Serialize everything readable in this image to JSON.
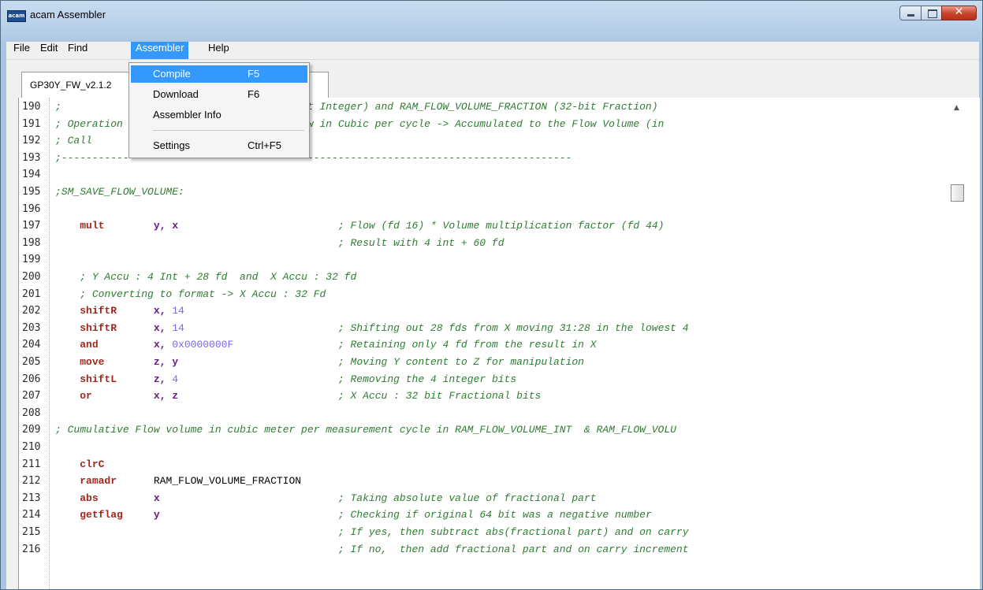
{
  "window": {
    "title": "acam Assembler",
    "app_icon_text": "acam"
  },
  "menubar": [
    "File",
    "Edit",
    "Find",
    "Assembler",
    "Help"
  ],
  "tab": {
    "label": "GP30Y_FW_v2.1.2"
  },
  "dropdown": {
    "items": [
      {
        "label": "Compile",
        "shortcut": "F5"
      },
      {
        "label": "Download",
        "shortcut": "F6"
      },
      {
        "label": "Assembler Info",
        "shortcut": ""
      },
      {
        "label": "Settings",
        "shortcut": "Ctrl+F5"
      }
    ]
  },
  "editor": {
    "lines": [
      {
        "n": "190",
        "parts": [
          {
            "c": "cm",
            "t": ";                       VOLUME_INT (32-bit Integer) and RAM_FLOW_VOLUME_FRACTION (32-bit Fraction)"
          }
        ]
      },
      {
        "n": "191",
        "parts": [
          {
            "c": "cm",
            "t": "; Operation : Flow * VOLUME_FACTOR -> Flow in Cubic per cycle -> Accumulated to the Flow Volume (in"
          }
        ]
      },
      {
        "n": "192",
        "parts": [
          {
            "c": "cm",
            "t": "; Call"
          }
        ]
      },
      {
        "n": "193",
        "parts": [
          {
            "c": "cm",
            "t": ";-----------------------------------------------------------------------------------"
          }
        ]
      },
      {
        "n": "194",
        "parts": []
      },
      {
        "n": "195",
        "parts": [
          {
            "c": "cm",
            "t": ";SM_SAVE_FLOW_VOLUME:"
          }
        ]
      },
      {
        "n": "196",
        "parts": []
      },
      {
        "n": "197",
        "parts": [
          {
            "c": "id",
            "t": "    "
          },
          {
            "c": "kw",
            "t": "mult"
          },
          {
            "c": "id",
            "t": "        "
          },
          {
            "c": "op",
            "t": "y, x"
          },
          {
            "c": "id",
            "t": "                          "
          },
          {
            "c": "cm",
            "t": "; Flow (fd 16) * Volume multiplication factor (fd 44)"
          }
        ]
      },
      {
        "n": "198",
        "parts": [
          {
            "c": "id",
            "t": "                                              "
          },
          {
            "c": "cm",
            "t": "; Result with 4 int + 60 fd"
          }
        ]
      },
      {
        "n": "199",
        "parts": []
      },
      {
        "n": "200",
        "parts": [
          {
            "c": "id",
            "t": "    "
          },
          {
            "c": "cm",
            "t": "; Y Accu : 4 Int + 28 fd  and  X Accu : 32 fd"
          }
        ]
      },
      {
        "n": "201",
        "parts": [
          {
            "c": "id",
            "t": "    "
          },
          {
            "c": "cm",
            "t": "; Converting to format -> X Accu : 32 Fd"
          }
        ]
      },
      {
        "n": "202",
        "parts": [
          {
            "c": "id",
            "t": "    "
          },
          {
            "c": "kw",
            "t": "shiftR"
          },
          {
            "c": "id",
            "t": "      "
          },
          {
            "c": "op",
            "t": "x, "
          },
          {
            "c": "num",
            "t": "14"
          }
        ]
      },
      {
        "n": "203",
        "parts": [
          {
            "c": "id",
            "t": "    "
          },
          {
            "c": "kw",
            "t": "shiftR"
          },
          {
            "c": "id",
            "t": "      "
          },
          {
            "c": "op",
            "t": "x, "
          },
          {
            "c": "num",
            "t": "14"
          },
          {
            "c": "id",
            "t": "                         "
          },
          {
            "c": "cm",
            "t": "; Shifting out 28 fds from X moving 31:28 in the lowest 4"
          }
        ]
      },
      {
        "n": "204",
        "parts": [
          {
            "c": "id",
            "t": "    "
          },
          {
            "c": "kw",
            "t": "and"
          },
          {
            "c": "id",
            "t": "         "
          },
          {
            "c": "op",
            "t": "x, "
          },
          {
            "c": "num",
            "t": "0x0000000F"
          },
          {
            "c": "id",
            "t": "                 "
          },
          {
            "c": "cm",
            "t": "; Retaining only 4 fd from the result in X"
          }
        ]
      },
      {
        "n": "205",
        "parts": [
          {
            "c": "id",
            "t": "    "
          },
          {
            "c": "kw",
            "t": "move"
          },
          {
            "c": "id",
            "t": "        "
          },
          {
            "c": "op",
            "t": "z, y"
          },
          {
            "c": "id",
            "t": "                          "
          },
          {
            "c": "cm",
            "t": "; Moving Y content to Z for manipulation"
          }
        ]
      },
      {
        "n": "206",
        "parts": [
          {
            "c": "id",
            "t": "    "
          },
          {
            "c": "kw",
            "t": "shiftL"
          },
          {
            "c": "id",
            "t": "      "
          },
          {
            "c": "op",
            "t": "z, "
          },
          {
            "c": "num",
            "t": "4"
          },
          {
            "c": "id",
            "t": "                          "
          },
          {
            "c": "cm",
            "t": "; Removing the 4 integer bits"
          }
        ]
      },
      {
        "n": "207",
        "parts": [
          {
            "c": "id",
            "t": "    "
          },
          {
            "c": "kw",
            "t": "or"
          },
          {
            "c": "id",
            "t": "          "
          },
          {
            "c": "op",
            "t": "x, z"
          },
          {
            "c": "id",
            "t": "                          "
          },
          {
            "c": "cm",
            "t": "; X Accu : 32 bit Fractional bits"
          }
        ]
      },
      {
        "n": "208",
        "parts": []
      },
      {
        "n": "209",
        "parts": [
          {
            "c": "cm",
            "t": "; Cumulative Flow volume in cubic meter per measurement cycle in RAM_FLOW_VOLUME_INT  & RAM_FLOW_VOLU"
          }
        ]
      },
      {
        "n": "210",
        "parts": []
      },
      {
        "n": "211",
        "parts": [
          {
            "c": "id",
            "t": "    "
          },
          {
            "c": "kw",
            "t": "clrC"
          }
        ]
      },
      {
        "n": "212",
        "parts": [
          {
            "c": "id",
            "t": "    "
          },
          {
            "c": "kw",
            "t": "ramadr"
          },
          {
            "c": "id",
            "t": "      RAM_FLOW_VOLUME_FRACTION"
          }
        ]
      },
      {
        "n": "213",
        "parts": [
          {
            "c": "id",
            "t": "    "
          },
          {
            "c": "kw",
            "t": "abs"
          },
          {
            "c": "id",
            "t": "         "
          },
          {
            "c": "op",
            "t": "x"
          },
          {
            "c": "id",
            "t": "                             "
          },
          {
            "c": "cm",
            "t": "; Taking absolute value of fractional part"
          }
        ]
      },
      {
        "n": "214",
        "parts": [
          {
            "c": "id",
            "t": "    "
          },
          {
            "c": "kw",
            "t": "getflag"
          },
          {
            "c": "id",
            "t": "     "
          },
          {
            "c": "op",
            "t": "y"
          },
          {
            "c": "id",
            "t": "                             "
          },
          {
            "c": "cm",
            "t": "; Checking if original 64 bit was a negative number"
          }
        ]
      },
      {
        "n": "215",
        "parts": [
          {
            "c": "id",
            "t": "                                              "
          },
          {
            "c": "cm",
            "t": "; If yes, then subtract abs(fractional part) and on carry"
          }
        ]
      },
      {
        "n": "216",
        "parts": [
          {
            "c": "id",
            "t": "                                              "
          },
          {
            "c": "cm",
            "t": "; If no,  then add fractional part and on carry increment"
          }
        ]
      }
    ]
  }
}
